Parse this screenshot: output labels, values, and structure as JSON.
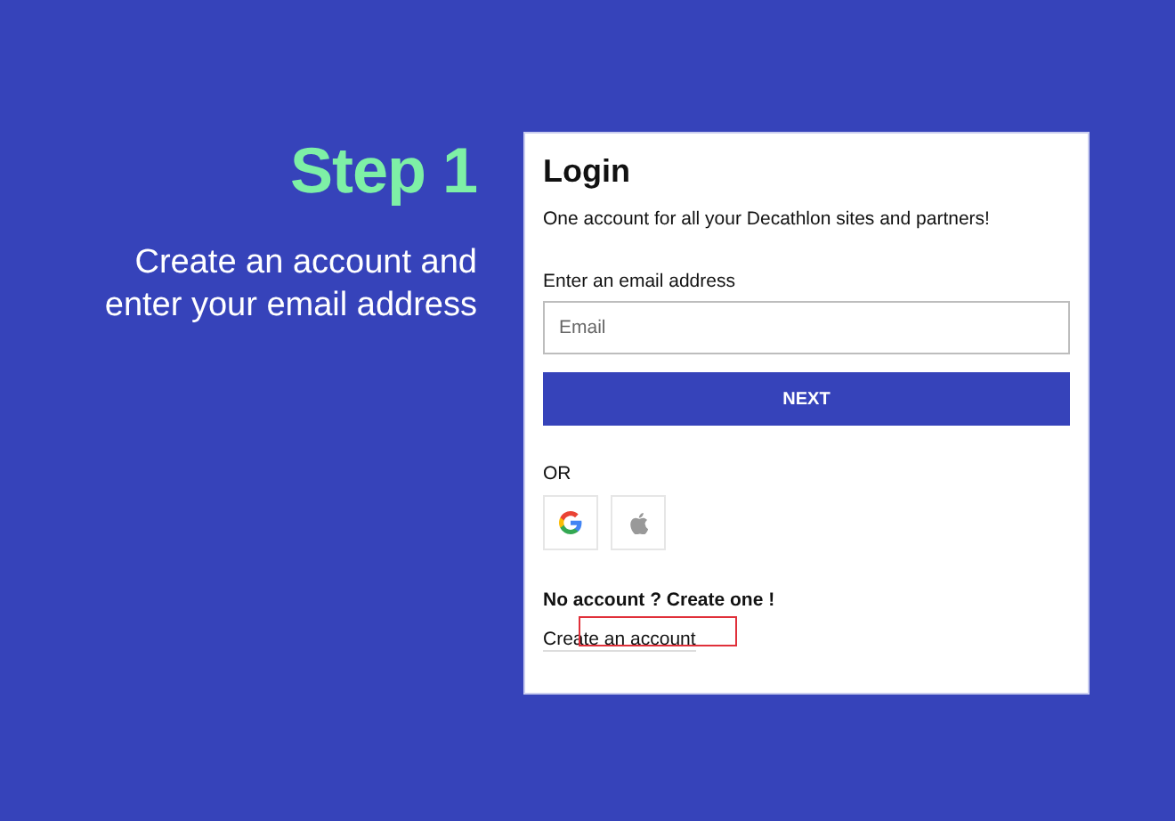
{
  "intro": {
    "step": "Step 1",
    "description": "Create an account and enter your email address"
  },
  "login": {
    "title": "Login",
    "subtitle": "One account for all your Decathlon sites and partners!",
    "email_label": "Enter an email address",
    "email_placeholder": "Email",
    "next_button": "NEXT",
    "or_label": "OR",
    "social_buttons": [
      {
        "kind": "google"
      },
      {
        "kind": "apple"
      }
    ],
    "signup_heading": "No account ? Create one !",
    "signup_link": "Create an account"
  }
}
